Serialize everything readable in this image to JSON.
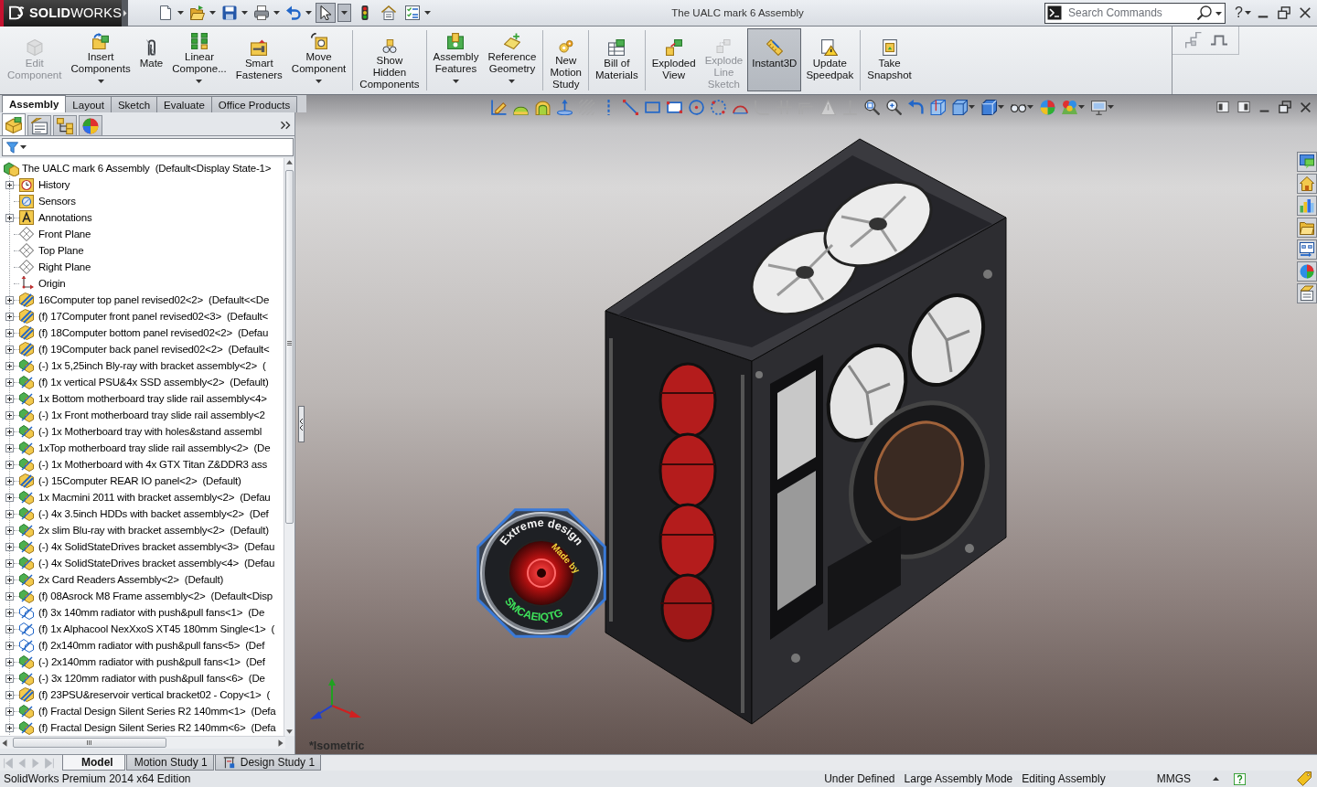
{
  "title_bar": {
    "logo": "**SOLID**WORKS",
    "title": "The UALC mark 6 Assembly",
    "search": {
      "placeholder": "Search Commands"
    },
    "help": "?"
  },
  "quick_access": [
    {
      "kind": "new",
      "menu": true,
      "pressed": false
    },
    {
      "kind": "open",
      "menu": true,
      "pressed": false
    },
    {
      "kind": "save",
      "menu": true,
      "pressed": false
    },
    {
      "kind": "print",
      "menu": true,
      "pressed": false
    },
    {
      "kind": "undo",
      "menu": true,
      "pressed": false
    },
    {
      "kind": "select",
      "menu": true,
      "pressed": true
    },
    {
      "kind": "rebuild",
      "menu": false,
      "pressed": false
    },
    {
      "kind": "properties",
      "menu": false,
      "pressed": false
    },
    {
      "kind": "options",
      "menu": true,
      "pressed": false
    }
  ],
  "command_manager": {
    "groups": [
      {
        "commands": [
          {
            "kind": "edit-component",
            "label": "Edit\nComponent",
            "disabled": true,
            "selected": false,
            "menu": false
          },
          {
            "kind": "insert-components",
            "label": "Insert\nComponents",
            "disabled": false,
            "selected": false,
            "menu": true
          },
          {
            "kind": "mate",
            "label": "Mate",
            "disabled": false,
            "selected": false,
            "menu": false
          },
          {
            "kind": "linear-pattern",
            "label": "Linear\nCompone...",
            "disabled": false,
            "selected": false,
            "menu": true
          },
          {
            "kind": "smart-fasteners",
            "label": "Smart\nFasteners",
            "disabled": false,
            "selected": false,
            "menu": false
          },
          {
            "kind": "move-component",
            "label": "Move\nComponent",
            "disabled": false,
            "selected": false,
            "menu": true
          }
        ]
      },
      {
        "commands": [
          {
            "kind": "show-hidden",
            "label": "Show\nHidden\nComponents",
            "disabled": false,
            "selected": false,
            "menu": false
          }
        ]
      },
      {
        "commands": [
          {
            "kind": "assembly-features",
            "label": "Assembly\nFeatures",
            "disabled": false,
            "selected": false,
            "menu": true
          },
          {
            "kind": "reference-geometry",
            "label": "Reference\nGeometry",
            "disabled": false,
            "selected": false,
            "menu": true
          }
        ]
      },
      {
        "commands": [
          {
            "kind": "motion-study",
            "label": "New\nMotion\nStudy",
            "disabled": false,
            "selected": false,
            "menu": false
          }
        ]
      },
      {
        "commands": [
          {
            "kind": "bom",
            "label": "Bill of\nMaterials",
            "disabled": false,
            "selected": false,
            "menu": false
          }
        ]
      },
      {
        "commands": [
          {
            "kind": "exploded-view",
            "label": "Exploded\nView",
            "disabled": false,
            "selected": false,
            "menu": false
          },
          {
            "kind": "explode-line-sketch",
            "label": "Explode\nLine\nSketch",
            "disabled": true,
            "selected": false,
            "menu": false
          },
          {
            "kind": "instant3d",
            "label": "Instant3D",
            "disabled": false,
            "selected": true,
            "menu": false
          },
          {
            "kind": "speedpak",
            "label": "Update\nSpeedpak",
            "disabled": false,
            "selected": false,
            "menu": false
          }
        ]
      },
      {
        "commands": [
          {
            "kind": "snapshot",
            "label": "Take\nSnapshot",
            "disabled": false,
            "selected": false,
            "menu": false
          }
        ]
      }
    ]
  },
  "command_tabs": [
    {
      "label": "Assembly",
      "selected": true
    },
    {
      "label": "Layout",
      "selected": false
    },
    {
      "label": "Sketch",
      "selected": false
    },
    {
      "label": "Evaluate",
      "selected": false
    },
    {
      "label": "Office Products",
      "selected": false
    }
  ],
  "view_toolbar": [
    {
      "kind": "sketch",
      "disabled": false,
      "menu": false
    },
    {
      "kind": "extrude",
      "disabled": false,
      "menu": false
    },
    {
      "kind": "revolve",
      "disabled": false,
      "menu": false
    },
    {
      "kind": "axis",
      "disabled": false,
      "menu": false
    },
    {
      "kind": "hatch",
      "disabled": true,
      "menu": false
    },
    {
      "kind": "centerline",
      "disabled": false,
      "menu": false
    },
    {
      "kind": "line",
      "disabled": false,
      "menu": false
    },
    {
      "kind": "rectangle",
      "disabled": false,
      "menu": false
    },
    {
      "kind": "corner-rectangle",
      "disabled": false,
      "menu": false
    },
    {
      "kind": "circle",
      "disabled": false,
      "menu": false
    },
    {
      "kind": "spline",
      "disabled": false,
      "menu": false
    },
    {
      "kind": "arc",
      "disabled": false,
      "menu": false
    },
    {
      "kind": "fillet",
      "disabled": true,
      "menu": false
    },
    {
      "kind": "trim",
      "disabled": true,
      "menu": false
    },
    {
      "kind": "offset",
      "disabled": true,
      "menu": false
    },
    {
      "kind": "triangle",
      "disabled": true,
      "menu": false
    },
    {
      "kind": "relation",
      "disabled": true,
      "menu": false
    },
    {
      "kind": "zoom-fit",
      "disabled": false,
      "menu": false
    },
    {
      "kind": "zoom-area",
      "disabled": false,
      "menu": false
    },
    {
      "kind": "previous-view",
      "disabled": false,
      "menu": false
    },
    {
      "kind": "section",
      "disabled": false,
      "menu": false
    },
    {
      "kind": "view-orientation",
      "disabled": false,
      "menu": true
    },
    {
      "kind": "display-style",
      "disabled": false,
      "menu": true
    },
    {
      "kind": "hide-show",
      "disabled": false,
      "menu": true
    },
    {
      "kind": "appearance",
      "disabled": false,
      "menu": false
    },
    {
      "kind": "scene",
      "disabled": false,
      "menu": true
    },
    {
      "kind": "view-settings",
      "disabled": false,
      "menu": true
    }
  ],
  "feature_manager": {
    "tabs": [
      {
        "kind": "feature-tree",
        "selected": true
      },
      {
        "kind": "property-manager",
        "selected": false
      },
      {
        "kind": "configuration-manager",
        "selected": false
      },
      {
        "kind": "display-manager",
        "selected": false
      }
    ],
    "tree": {
      "label": "The UALC mark 6 Assembly  (Default<Display State-1>",
      "kind": "assembly-root",
      "children": [
        {
          "label": "History",
          "kind": "history",
          "expand_box": true
        },
        {
          "label": "Sensors",
          "kind": "sensors",
          "expand_box": false
        },
        {
          "label": "Annotations",
          "kind": "annotations",
          "expand_box": true
        },
        {
          "label": "Front Plane",
          "kind": "plane",
          "expand_box": false
        },
        {
          "label": "Top Plane",
          "kind": "plane",
          "expand_box": false
        },
        {
          "label": "Right Plane",
          "kind": "plane",
          "expand_box": false
        },
        {
          "label": "Origin",
          "kind": "origin",
          "expand_box": false
        },
        {
          "label": "16Computer top panel revised02<2>  (Default<<De",
          "kind": "part",
          "expand_box": true
        },
        {
          "label": "(f) 17Computer front panel revised02<3>  (Default<",
          "kind": "part",
          "expand_box": true
        },
        {
          "label": "(f) 18Computer bottom panel revised02<2>  (Defau",
          "kind": "part",
          "expand_box": true
        },
        {
          "label": "(f) 19Computer back panel revised02<2>  (Default<",
          "kind": "part",
          "expand_box": true
        },
        {
          "label": "(-) 1x 5,25inch Bly-ray with bracket assembly<2>  (",
          "kind": "assembly",
          "expand_box": true
        },
        {
          "label": "(f) 1x vertical PSU&4x SSD assembly<2>  (Default)",
          "kind": "assembly",
          "expand_box": true
        },
        {
          "label": "1x Bottom motherboard tray slide rail assembly<4>",
          "kind": "assembly",
          "expand_box": true
        },
        {
          "label": "(-) 1x Front motherboard tray slide rail assembly<2",
          "kind": "assembly",
          "expand_box": true
        },
        {
          "label": "(-) 1x Motherboard tray with holes&stand assembl",
          "kind": "assembly",
          "expand_box": true
        },
        {
          "label": "1xTop motherboard tray slide rail assembly<2>  (De",
          "kind": "assembly",
          "expand_box": true
        },
        {
          "label": "(-) 1x Motherboard with 4x GTX Titan Z&DDR3 ass",
          "kind": "assembly",
          "expand_box": true
        },
        {
          "label": "(-) 15Computer REAR IO panel<2>  (Default)",
          "kind": "part",
          "expand_box": true
        },
        {
          "label": "1x Macmini 2011 with bracket assembly<2>  (Defau",
          "kind": "assembly",
          "expand_box": true
        },
        {
          "label": "(-) 4x 3.5inch HDDs with backet assembly<2>  (Def",
          "kind": "assembly",
          "expand_box": true
        },
        {
          "label": "2x slim Blu-ray with bracket assembly<2>  (Default)",
          "kind": "assembly",
          "expand_box": true
        },
        {
          "label": "(-) 4x SolidStateDrives bracket assembly<3>  (Defau",
          "kind": "assembly",
          "expand_box": true
        },
        {
          "label": "(-) 4x SolidStateDrives bracket assembly<4>  (Defau",
          "kind": "assembly",
          "expand_box": true
        },
        {
          "label": "2x Card Readers Assembly<2>  (Default)",
          "kind": "assembly",
          "expand_box": true
        },
        {
          "label": "(f) 08Asrock M8 Frame assembly<2>  (Default<Disp",
          "kind": "assembly",
          "expand_box": true
        },
        {
          "label": "(f) 3x 140mm radiator with push&pull fans<1>  (De",
          "kind": "hidden-assembly",
          "expand_box": true
        },
        {
          "label": "(f) 1x Alphacool NexXxoS XT45 180mm Single<1>  (",
          "kind": "hidden-assembly",
          "expand_box": true
        },
        {
          "label": "(f) 2x140mm radiator with push&pull fans<5>  (Def",
          "kind": "hidden-assembly",
          "expand_box": true
        },
        {
          "label": "(-) 2x140mm radiator with push&pull fans<1>  (Def",
          "kind": "assembly",
          "expand_box": true
        },
        {
          "label": "(-) 3x 120mm radiator with push&pull fans<6>  (De",
          "kind": "assembly",
          "expand_box": true
        },
        {
          "label": "(f) 23PSU&reservoir vertical bracket02 - Copy<1>  (",
          "kind": "part",
          "expand_box": true
        },
        {
          "label": "(f) Fractal Design Silent Series R2 140mm<1>  (Defa",
          "kind": "assembly",
          "expand_box": true
        },
        {
          "label": "(f) Fractal Design Silent Series R2 140mm<6>  (Defa",
          "kind": "assembly",
          "expand_box": true
        }
      ]
    }
  },
  "viewport": {
    "view_label": "*Isometric",
    "emblem": {
      "top_text": "Extreme design",
      "middle_text": "Made by",
      "bottom_text": "SMCAEIQTG"
    }
  },
  "bottom_tabs": [
    {
      "label": "Model",
      "kind": "model",
      "selected": true
    },
    {
      "label": "Motion Study 1",
      "kind": "motion",
      "selected": false
    },
    {
      "label": "Design Study 1",
      "kind": "design",
      "selected": false
    }
  ],
  "status_bar": {
    "edition": "SolidWorks Premium 2014 x64 Edition",
    "items": [
      "Under Defined",
      "Large Assembly Mode",
      "Editing Assembly"
    ],
    "units": "MMGS"
  }
}
